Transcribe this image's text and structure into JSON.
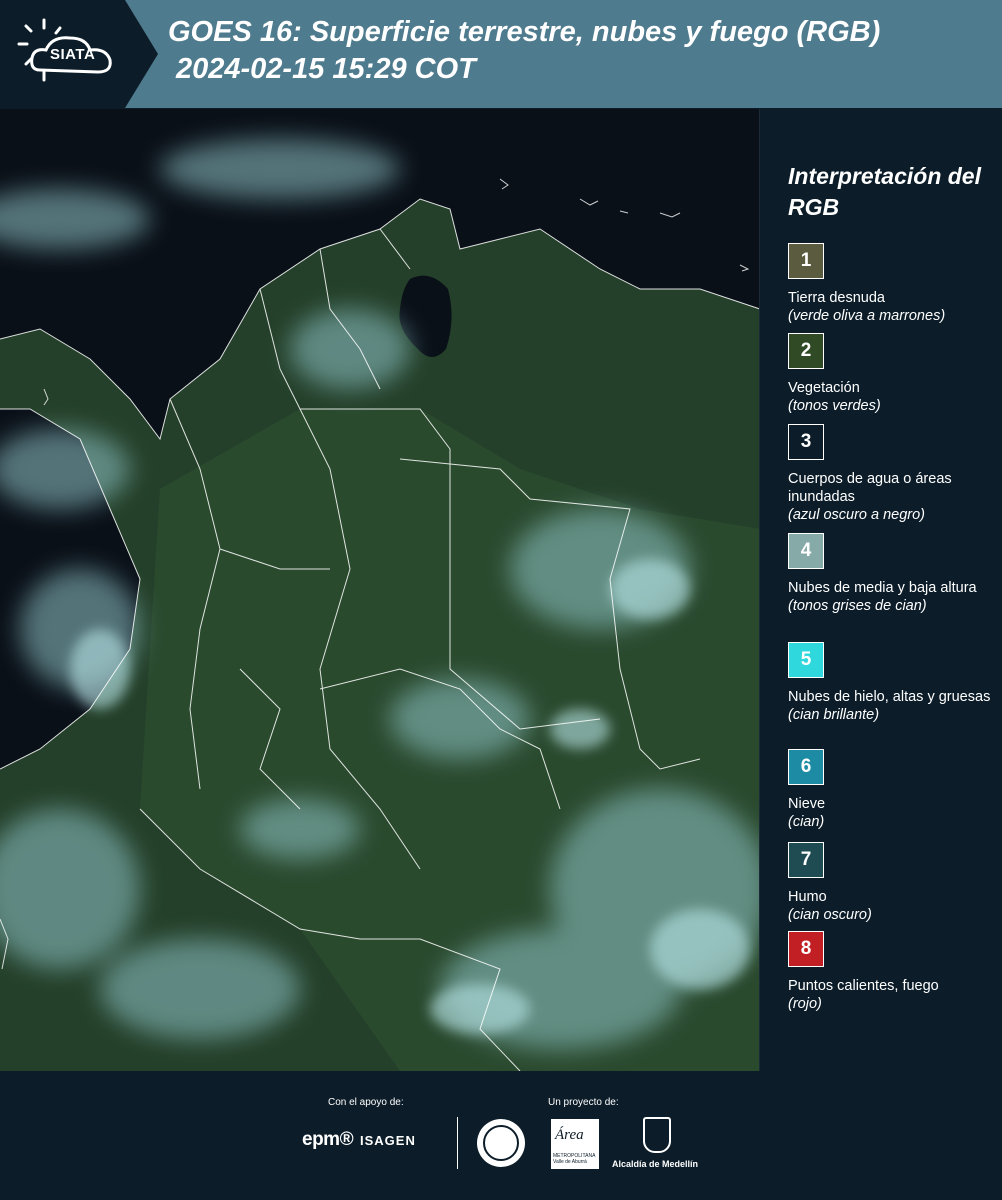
{
  "header": {
    "logo_text": "SIATA",
    "title_line1": "GOES 16: Superficie terrestre, nubes y fuego (RGB)",
    "title_line2": "2024-02-15 15:29 COT"
  },
  "legend": {
    "title": "Interpretación del RGB",
    "items": [
      {
        "number": "1",
        "label": "Tierra desnuda",
        "sub": "(verde oliva a marrones)",
        "color": "#5b5b3f"
      },
      {
        "number": "2",
        "label": "Vegetación",
        "sub": "(tonos verdes)",
        "color": "#2f4a24"
      },
      {
        "number": "3",
        "label": "Cuerpos de agua o áreas inundadas",
        "sub": "(azul oscuro a negro)",
        "color": "#0c1d29"
      },
      {
        "number": "4",
        "label": "Nubes de media y baja altura",
        "sub": "(tonos grises de cian)",
        "color": "#86aaa8"
      },
      {
        "number": "5",
        "label": "Nubes de hielo, altas y gruesas",
        "sub": "(cian brillante)",
        "color": "#2ed8dc"
      },
      {
        "number": "6",
        "label": "Nieve",
        "sub": "(cian)",
        "color": "#1c8ba3"
      },
      {
        "number": "7",
        "label": "Humo",
        "sub": "(cian oscuro)",
        "color": "#1f4c52"
      },
      {
        "number": "8",
        "label": "Puntos calientes, fuego",
        "sub": "(rojo)",
        "color": "#c11f23"
      }
    ]
  },
  "footer": {
    "support_label": "Con el apoyo de:",
    "project_label": "Un proyecto de:",
    "epm": "epm®",
    "isagen": "ISAGEN",
    "area_logo": "Área",
    "area_small": "METROPOLITANA Valle de Aburrá",
    "alcaldia": "Alcaldía de Medellín"
  },
  "colors": {
    "header_bg": "#4f7b8e",
    "page_bg": "#0c1d29",
    "vegetation": "#2d4a2e",
    "clouds": "#8fc4c8",
    "border_lines": "#ffffff"
  }
}
